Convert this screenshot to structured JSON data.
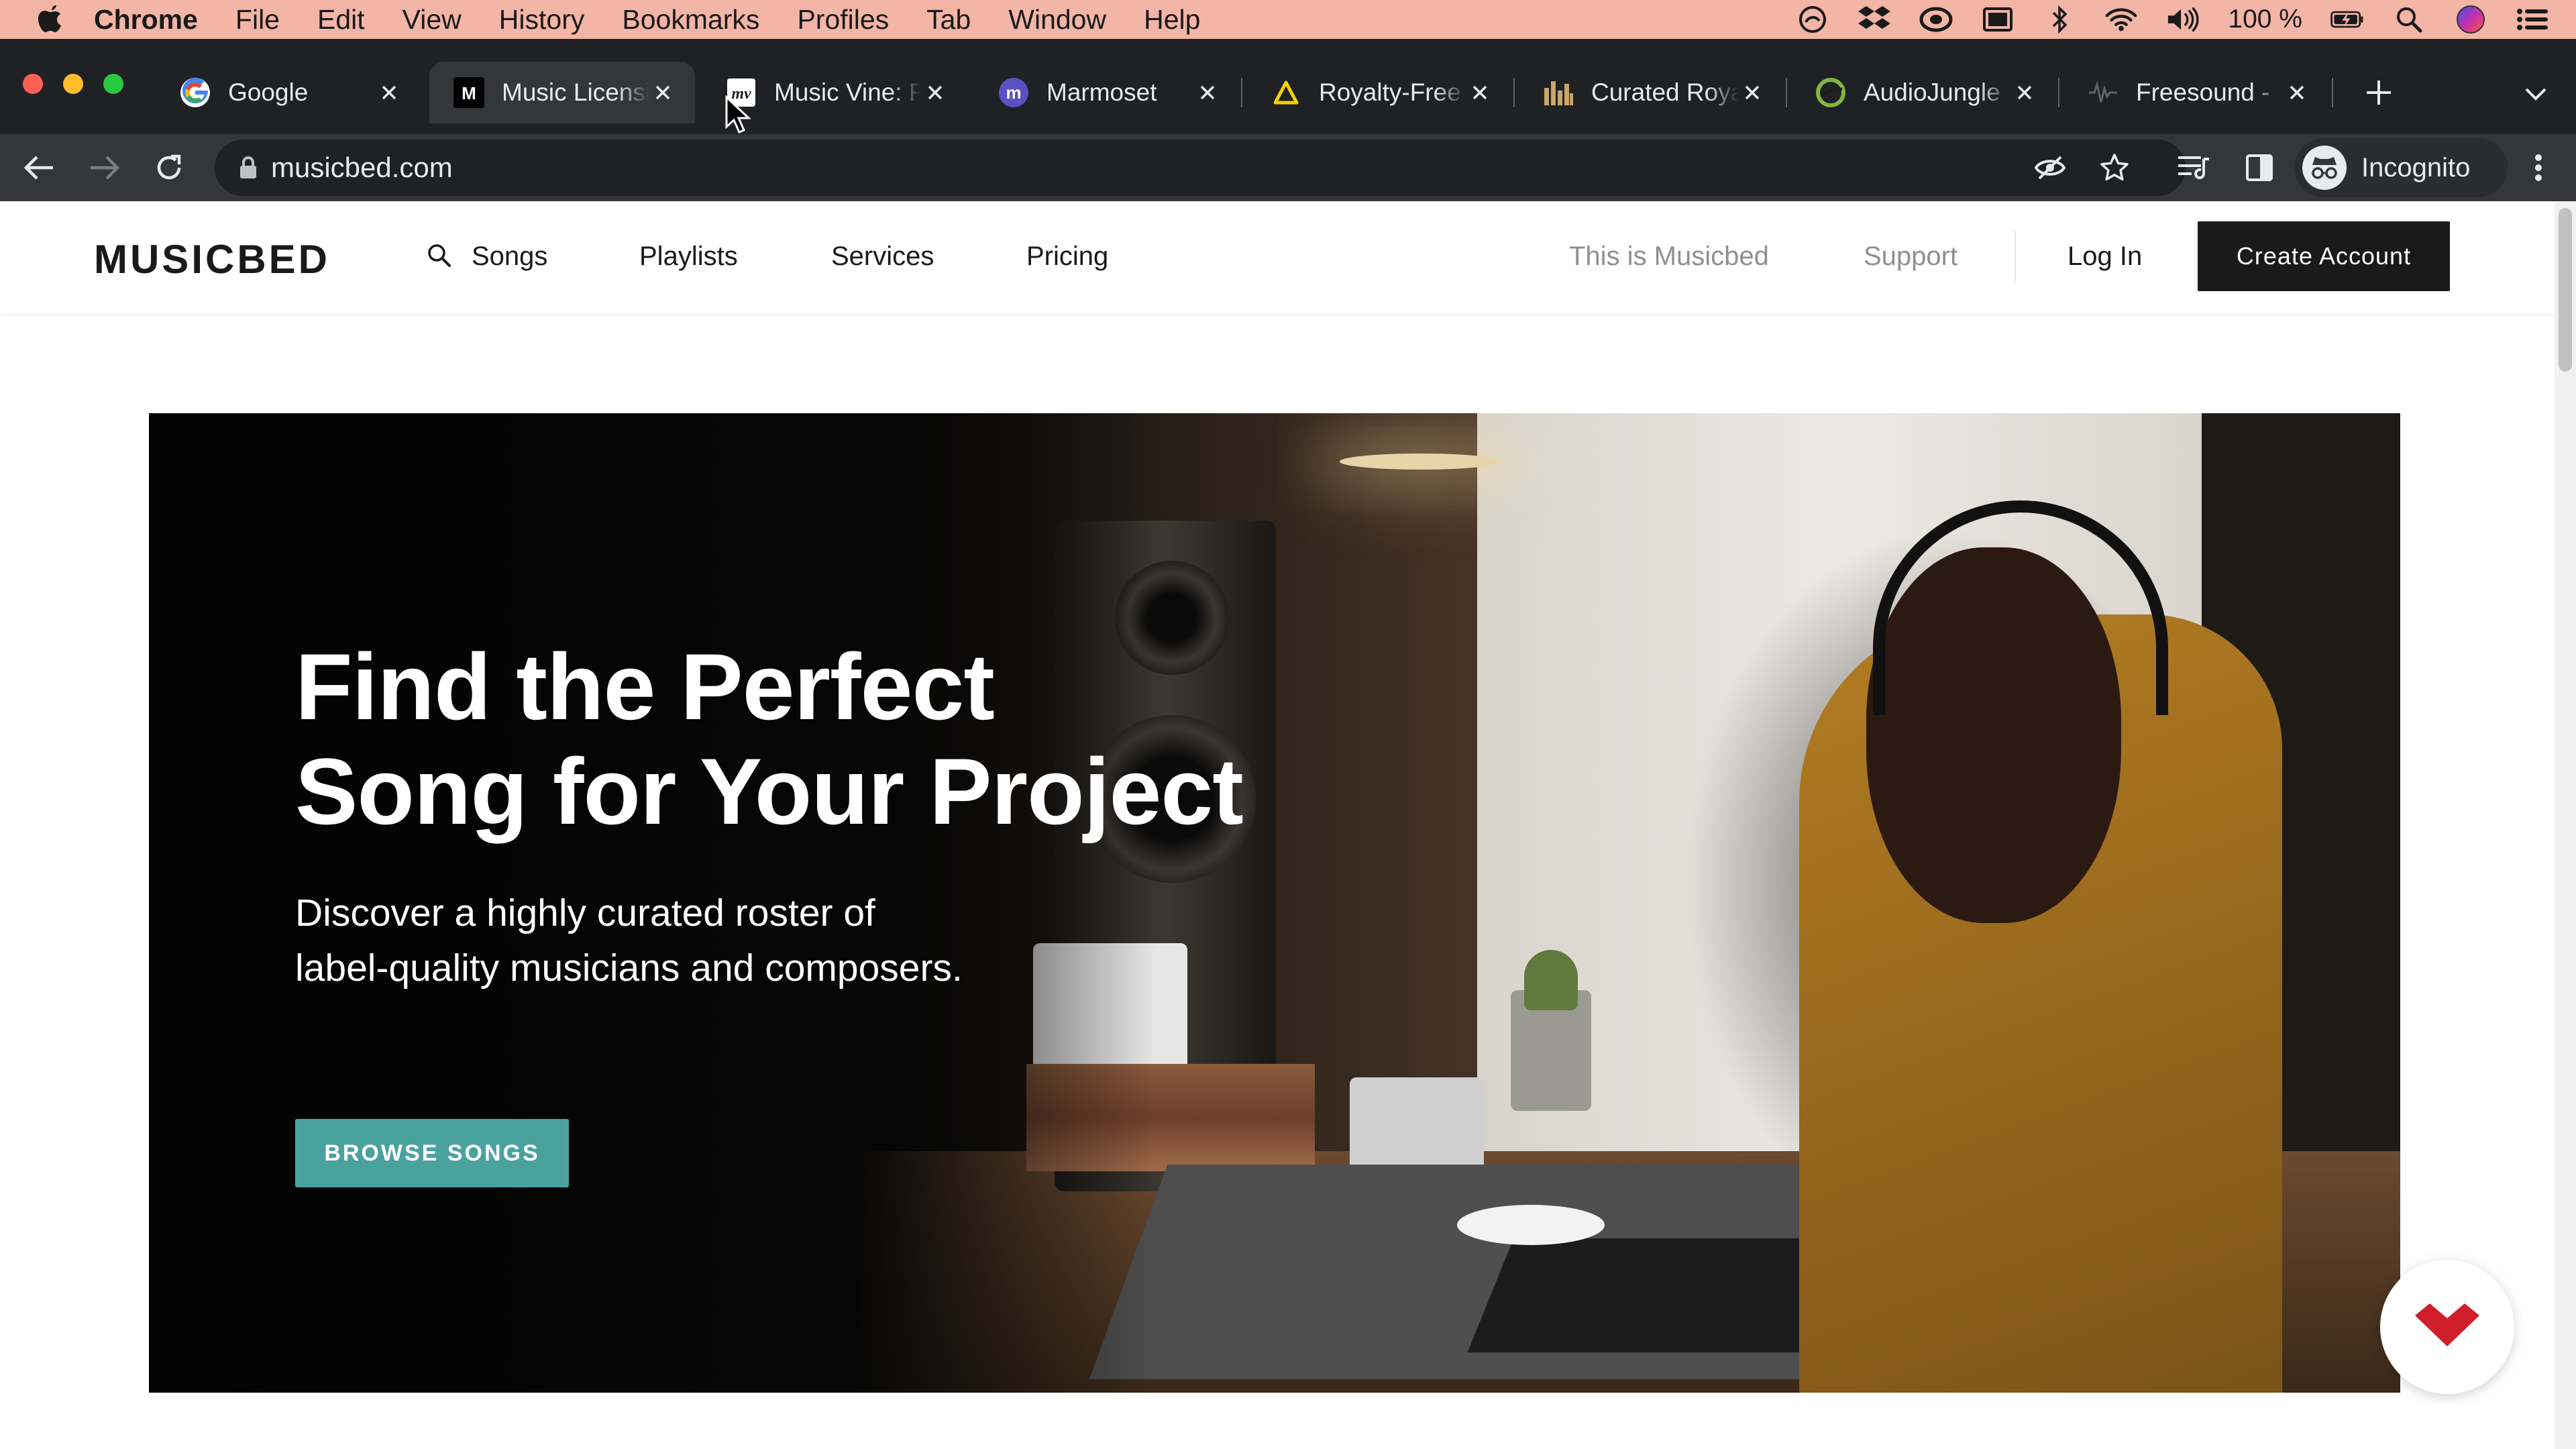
{
  "menubar": {
    "app": "Chrome",
    "items": [
      "File",
      "Edit",
      "View",
      "History",
      "Bookmarks",
      "Profiles",
      "Tab",
      "Window",
      "Help"
    ],
    "battery": "100 %"
  },
  "tabs": [
    {
      "title": "Google",
      "favicon": "google-icon"
    },
    {
      "title": "Music Licensing",
      "favicon": "musicbed-icon",
      "active": true
    },
    {
      "title": "Music Vine: Royalty",
      "favicon": "musicvine-icon"
    },
    {
      "title": "Marmoset",
      "favicon": "marmoset-icon"
    },
    {
      "title": "Royalty-Free Music",
      "favicon": "artlist-icon"
    },
    {
      "title": "Curated Royalty",
      "favicon": "bars-icon"
    },
    {
      "title": "AudioJungle",
      "favicon": "audiojungle-icon"
    },
    {
      "title": "Freesound - ",
      "favicon": "freesound-icon"
    }
  ],
  "toolbar": {
    "url": "musicbed.com",
    "profile": "Incognito"
  },
  "site": {
    "brand": "MUSICBED",
    "nav": {
      "songs": "Songs",
      "playlists": "Playlists",
      "services": "Services",
      "pricing": "Pricing",
      "about": "This is Musicbed",
      "support": "Support",
      "login": "Log In",
      "create": "Create Account"
    },
    "hero": {
      "title_line1": "Find the Perfect",
      "title_line2": "Song for Your Project",
      "subtitle_line1": "Discover a highly curated roster of",
      "subtitle_line2": "label-quality musicians and composers.",
      "cta": "BROWSE SONGS"
    }
  },
  "colors": {
    "menubar": "#f2b5a6",
    "chrome_dark": "#202124",
    "chrome_tab": "#35363a",
    "cta": "#4aa29f",
    "brand_dark": "#1a1a1a",
    "widget_red": "#d01f2a"
  }
}
